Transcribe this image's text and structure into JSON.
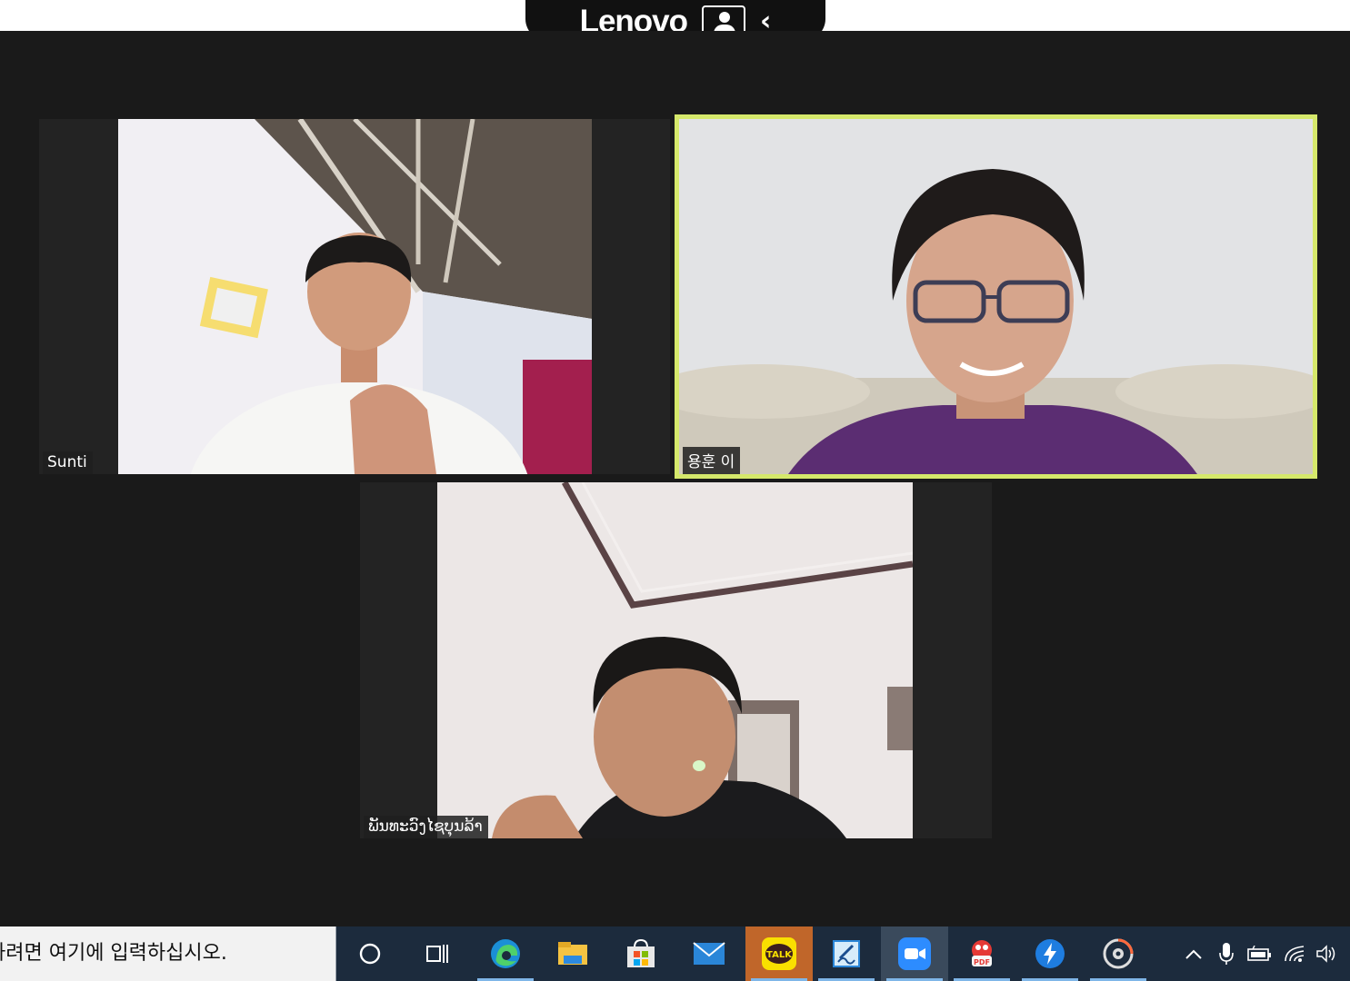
{
  "oem": {
    "brand": "Lenovo"
  },
  "participants": [
    {
      "name": "Sunti",
      "speaking": false
    },
    {
      "name": "용훈 이",
      "speaking": true
    },
    {
      "name": "ພັນທະວົງໄຊບຸນລ້າ",
      "speaking": false
    }
  ],
  "taskbar": {
    "search_text": "하려면 여기에 입력하십시오.",
    "apps": [
      {
        "icon": "cortana-circle-icon"
      },
      {
        "icon": "task-view-icon"
      },
      {
        "icon": "edge-browser-icon"
      },
      {
        "icon": "file-explorer-icon"
      },
      {
        "icon": "microsoft-store-icon"
      },
      {
        "icon": "mail-icon"
      },
      {
        "icon": "kakaotalk-icon",
        "label": "TALK"
      },
      {
        "icon": "notepad-app-icon"
      },
      {
        "icon": "zoom-icon"
      },
      {
        "icon": "pdf-app-icon",
        "label": "PDF"
      },
      {
        "icon": "lightning-app-icon"
      },
      {
        "icon": "media-player-icon"
      }
    ],
    "tray": [
      {
        "icon": "show-hidden-chevron-icon"
      },
      {
        "icon": "microphone-icon"
      },
      {
        "icon": "battery-icon"
      },
      {
        "icon": "wifi-icon"
      },
      {
        "icon": "volume-icon"
      }
    ]
  },
  "colors": {
    "meeting_bg": "#1a1a1a",
    "speaker_border": "#d5e86b",
    "taskbar_bg": "#1c2b3d",
    "kakaotalk_active": "#c0662a"
  }
}
